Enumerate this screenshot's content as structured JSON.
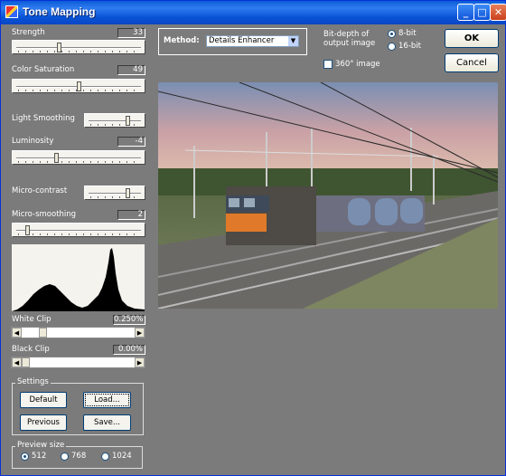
{
  "window": {
    "title": "Tone Mapping"
  },
  "controls": {
    "strength": {
      "label": "Strength",
      "value": "33",
      "level": 0.33
    },
    "color_saturation": {
      "label": "Color Saturation",
      "value": "49",
      "level": 0.49
    },
    "light_smoothing": {
      "label": "Light Smoothing",
      "level": 0.75
    },
    "luminosity": {
      "label": "Luminosity",
      "value": "-4",
      "level": 0.33
    },
    "micro_contrast": {
      "label": "Micro-contrast",
      "level": 0.75
    },
    "micro_smoothing": {
      "label": "Micro-smoothing",
      "value": "2",
      "level": 0.1
    },
    "white_clip": {
      "label": "White Clip",
      "value": "0.250%",
      "level": 0.2
    },
    "black_clip": {
      "label": "Black Clip",
      "value": "0.00%",
      "level": 0.0
    }
  },
  "settings": {
    "title": "Settings",
    "default_label": "Default",
    "load_label": "Load...",
    "previous_label": "Previous",
    "save_label": "Save..."
  },
  "preview": {
    "title": "Preview size",
    "options": [
      "512",
      "768",
      "1024"
    ],
    "selected": "512"
  },
  "method": {
    "label": "Method:",
    "value": "Details Enhancer"
  },
  "bit_depth": {
    "label_line1": "Bit-depth of",
    "label_line2": "output image",
    "options": [
      "8-bit",
      "16-bit"
    ],
    "selected": "8-bit"
  },
  "image360": {
    "label": "360° image",
    "checked": false
  },
  "buttons": {
    "ok": "OK",
    "cancel": "Cancel"
  },
  "icons": {
    "app": "app-icon",
    "minimize": "minimize-icon",
    "maximize": "maximize-icon",
    "close": "close-icon"
  }
}
